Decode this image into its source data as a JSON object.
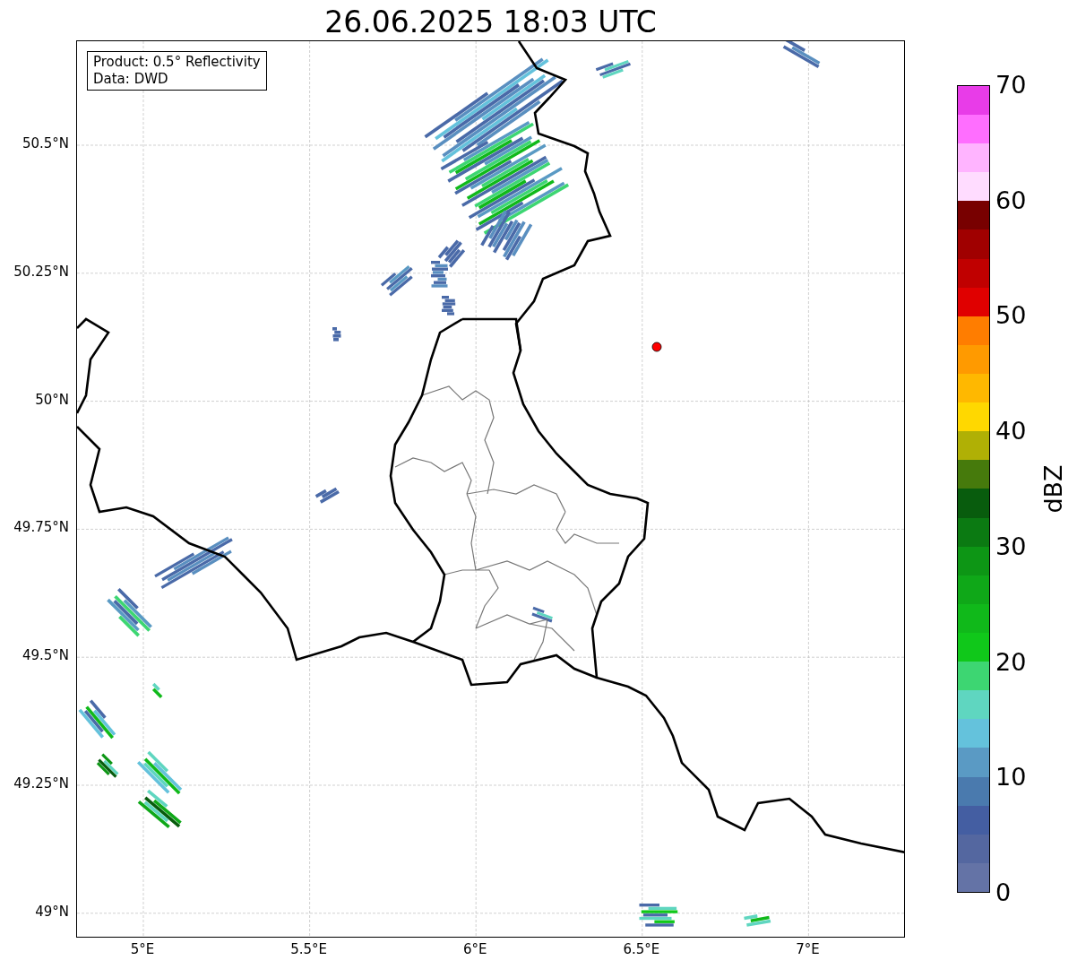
{
  "title": "26.06.2025 18:03 UTC",
  "legend": [
    "Product: 0.5° Reflectivity",
    "Data: DWD"
  ],
  "map": {
    "x_ticks": [
      "5°E",
      "5.5°E",
      "6°E",
      "6.5°E",
      "7°E"
    ],
    "y_ticks": [
      "50.5°N",
      "50.25°N",
      "50°N",
      "49.75°N",
      "49.5°N",
      "49.25°N",
      "49°N"
    ]
  },
  "colorbar": {
    "label": "dBZ",
    "ticks": [
      "70",
      "60",
      "50",
      "40",
      "30",
      "20",
      "10",
      "0"
    ],
    "bins": [
      {
        "color": "#6473a6"
      },
      {
        "color": "#5467a0"
      },
      {
        "color": "#445ea2"
      },
      {
        "color": "#4a7aae"
      },
      {
        "color": "#5a9ac4"
      },
      {
        "color": "#64c2dc"
      },
      {
        "color": "#5fd6c0"
      },
      {
        "color": "#3dd672"
      },
      {
        "color": "#10c81a"
      },
      {
        "color": "#10b91a"
      },
      {
        "color": "#0fa818"
      },
      {
        "color": "#0d9615"
      },
      {
        "color": "#0b7a12"
      },
      {
        "color": "#085c0d"
      },
      {
        "color": "#467a0c"
      },
      {
        "color": "#b0b005"
      },
      {
        "color": "#ffd800"
      },
      {
        "color": "#ffb800"
      },
      {
        "color": "#ff9a00"
      },
      {
        "color": "#ff7d00"
      },
      {
        "color": "#e00000"
      },
      {
        "color": "#c00000"
      },
      {
        "color": "#a00000"
      },
      {
        "color": "#780000"
      },
      {
        "color": "#ffdcff"
      },
      {
        "color": "#ffb4ff"
      },
      {
        "color": "#ff6eff"
      },
      {
        "color": "#e83ce8"
      }
    ]
  }
}
